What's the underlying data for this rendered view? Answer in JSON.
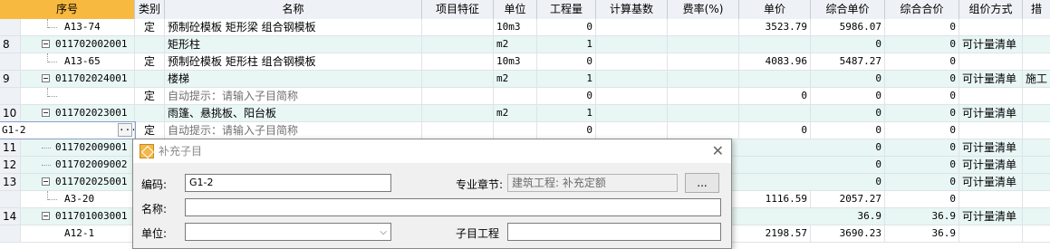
{
  "header": {
    "cols": [
      "序号",
      "类别",
      "名称",
      "项目特征",
      "单位",
      "工程量",
      "计算基数",
      "费率(%)",
      "单价",
      "综合单价",
      "综合合价",
      "组价方式",
      "措"
    ]
  },
  "rows": [
    {
      "seq": "",
      "code": "A13-74",
      "type": "定",
      "name": "预制砼模板 矩形梁 组合钢模板",
      "unit": "10m3",
      "qty": "0",
      "price": "3523.79",
      "uprice": "5986.07",
      "total": "0",
      "method": ""
    },
    {
      "seq": "8",
      "code": "011702002001",
      "type": "",
      "name": "矩形柱",
      "unit": "m2",
      "qty": "1",
      "price": "",
      "uprice": "0",
      "total": "0",
      "method": "可计量清单"
    },
    {
      "seq": "",
      "code": "A13-65",
      "type": "定",
      "name": "预制砼模板 矩形柱 组合钢模板",
      "unit": "10m3",
      "qty": "0",
      "price": "4083.96",
      "uprice": "5487.27",
      "total": "0",
      "method": ""
    },
    {
      "seq": "9",
      "code": "011702024001",
      "type": "",
      "name": "楼梯",
      "unit": "m2",
      "qty": "1",
      "price": "",
      "uprice": "0",
      "total": "0",
      "method": "可计量清单",
      "extra": "施工"
    },
    {
      "seq": "",
      "code": "",
      "type": "定",
      "name": "自动提示：请输入子目简称",
      "unit": "",
      "qty": "0",
      "price": "0",
      "uprice": "0",
      "total": "0",
      "method": ""
    },
    {
      "seq": "10",
      "code": "011702023001",
      "type": "",
      "name": "雨篷、悬挑板、阳台板",
      "unit": "m2",
      "qty": "1",
      "price": "",
      "uprice": "0",
      "total": "0",
      "method": "可计量清单"
    },
    {
      "seq": "G1-2",
      "code": "",
      "type": "定",
      "name": "自动提示：请输入子目简称",
      "unit": "",
      "qty": "0",
      "price": "0",
      "uprice": "0",
      "total": "0",
      "method": ""
    },
    {
      "seq": "11",
      "code": "011702009001",
      "type": "",
      "name": "",
      "unit": "",
      "qty": "",
      "price": "",
      "uprice": "0",
      "total": "0",
      "method": "可计量清单"
    },
    {
      "seq": "12",
      "code": "011702009002",
      "type": "",
      "name": "",
      "unit": "",
      "qty": "",
      "price": "",
      "uprice": "0",
      "total": "0",
      "method": "可计量清单"
    },
    {
      "seq": "13",
      "code": "011702025001",
      "type": "",
      "name": "",
      "unit": "",
      "qty": "",
      "price": "",
      "uprice": "0",
      "total": "0",
      "method": "可计量清单"
    },
    {
      "seq": "",
      "code": "A3-20",
      "type": "",
      "name": "",
      "unit": "",
      "qty": "",
      "price": "1116.59",
      "uprice": "2057.27",
      "total": "0",
      "method": ""
    },
    {
      "seq": "14",
      "code": "011701003001",
      "type": "",
      "name": "",
      "unit": "",
      "qty": "",
      "price": "",
      "uprice": "36.9",
      "total": "36.9",
      "method": "可计量清单"
    },
    {
      "seq": "",
      "code": "A12-1",
      "type": "",
      "name": "",
      "unit": "",
      "qty": "",
      "price": "2198.57",
      "uprice": "3690.23",
      "total": "36.9",
      "method": ""
    }
  ],
  "dialog": {
    "title": "补充子目",
    "code_label": "编码:",
    "code_value": "G1-2",
    "chapter_label": "专业章节:",
    "chapter_value": "建筑工程: 补充定额",
    "browse_label": "...",
    "name_label": "名称:",
    "unit_label": "单位:",
    "sub_label": "子目工程"
  },
  "colors": {
    "header_selected": "#f8b940",
    "row_teal": "#e8f6f4",
    "header_bg": "#eef1f5"
  }
}
